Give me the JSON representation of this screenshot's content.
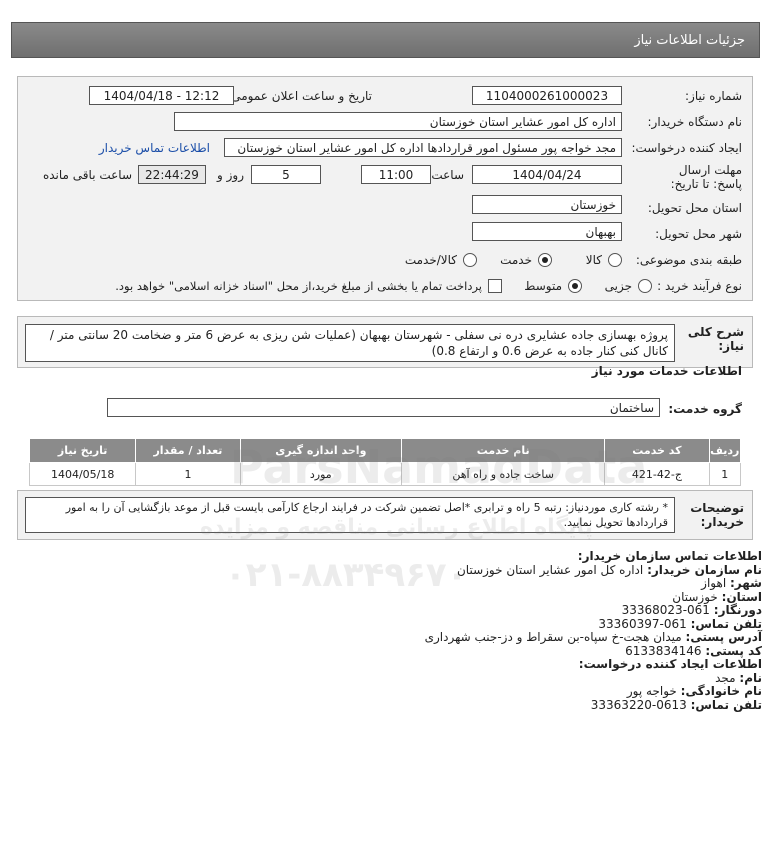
{
  "header": {
    "title": "جزئیات اطلاعات نیاز"
  },
  "form": {
    "need_number_label": "شماره نیاز:",
    "need_number": "1104000261000023",
    "announce_label": "تاریخ و ساعت اعلان عمومی:",
    "announce_value": "1404/04/18 - 12:12",
    "buyer_label": "نام دستگاه خریدار:",
    "buyer_value": "اداره کل امور عشایر استان خوزستان",
    "creator_label": "ایجاد کننده درخواست:",
    "creator_value": "مجد خواجه پور مسئول امور قراردادها اداره کل امور عشایر استان خوزستان",
    "contact_link": "اطلاعات تماس خریدار",
    "deadline_label": "مهلت ارسال پاسخ: تا تاریخ:",
    "deadline_date": "1404/04/24",
    "time_label": "ساعت",
    "deadline_time": "11:00",
    "days_value": "5",
    "days_label": "روز و",
    "remaining_value": "22:44:29",
    "remaining_label": "ساعت باقی مانده",
    "province_label": "استان محل تحویل:",
    "province_value": "خوزستان",
    "city_label": "شهر محل تحویل:",
    "city_value": "بهبهان",
    "category_label": "طبقه بندی موضوعی:",
    "category_options": [
      "کالا",
      "خدمت",
      "کالا/خدمت"
    ],
    "process_label": "نوع فرآیند خرید :",
    "process_options": [
      "جزیی",
      "متوسط"
    ],
    "payment_note": "پرداخت تمام یا بخشی از مبلغ خرید،از محل \"اسناد خزانه اسلامی\" خواهد بود."
  },
  "summary": {
    "label": "شرح کلی نیاز:",
    "text": "پروژه بهسازی جاده عشایری دره نی سفلی - شهرستان بهبهان (عملیات شن ریزی به عرض 6 متر و ضخامت 20 سانتی متر / کانال کنی کنار جاده به عرض 0.6 و ارتفاع 0.8)"
  },
  "services": {
    "section_title": "اطلاعات خدمات مورد نیاز",
    "group_label": "گروه خدمت:",
    "group_value": "ساختمان",
    "columns": [
      "ردیف",
      "کد خدمت",
      "نام خدمت",
      "واحد اندازه گیری",
      "تعداد / مقدار",
      "تاریخ نیاز"
    ],
    "rows": [
      [
        "1",
        "ج-42-421",
        "ساخت جاده و راه آهن",
        "مورد",
        "1",
        "1404/05/18"
      ]
    ]
  },
  "buyer_notes": {
    "label": "توضیحات خریدار:",
    "text": "* رشته کاری موردنیاز: رتبه 5 راه و ترابری *اصل تضمین شرکت در فرایند ارجاع کارآمی بایست قبل از موعد بازگشایی آن را به امور قراردادها تحویل نمایید."
  },
  "contact": {
    "title": "اطلاعات تماس سازمان خریدار:",
    "org_label": "نام سازمان خریدار:",
    "org_value": "اداره کل امور عشایر استان خوزستان",
    "city_label": "شهر:",
    "city_value": "اهواز",
    "province_label": "استان:",
    "province_value": "خوزستان",
    "fax_label": "دورنگار:",
    "fax_value": "061-33368023",
    "phone_label": "تلفن تماس:",
    "phone_value": "061-33360397",
    "address_label": "آدرس پستی:",
    "address_value": "میدان هجت-خ سپاه-بن سقراط و دز-جنب شهرداری",
    "postal_label": "کد پستی:",
    "postal_value": "6133834146",
    "creator_title": "اطلاعات ایجاد کننده درخواست:",
    "name_label": "نام:",
    "name_value": "مجد",
    "family_label": "نام خانوادگی:",
    "family_value": "خواجه پور",
    "cphone_label": "تلفن تماس:",
    "cphone_value": "0613-33363220"
  },
  "watermark": {
    "brand": "ParsNamadData",
    "slogan": "پایگاه اطلاع رسانی مناقصه و مزایده",
    "phone": "۰۲۱-۸۸۳۴۹۶۷۰"
  }
}
